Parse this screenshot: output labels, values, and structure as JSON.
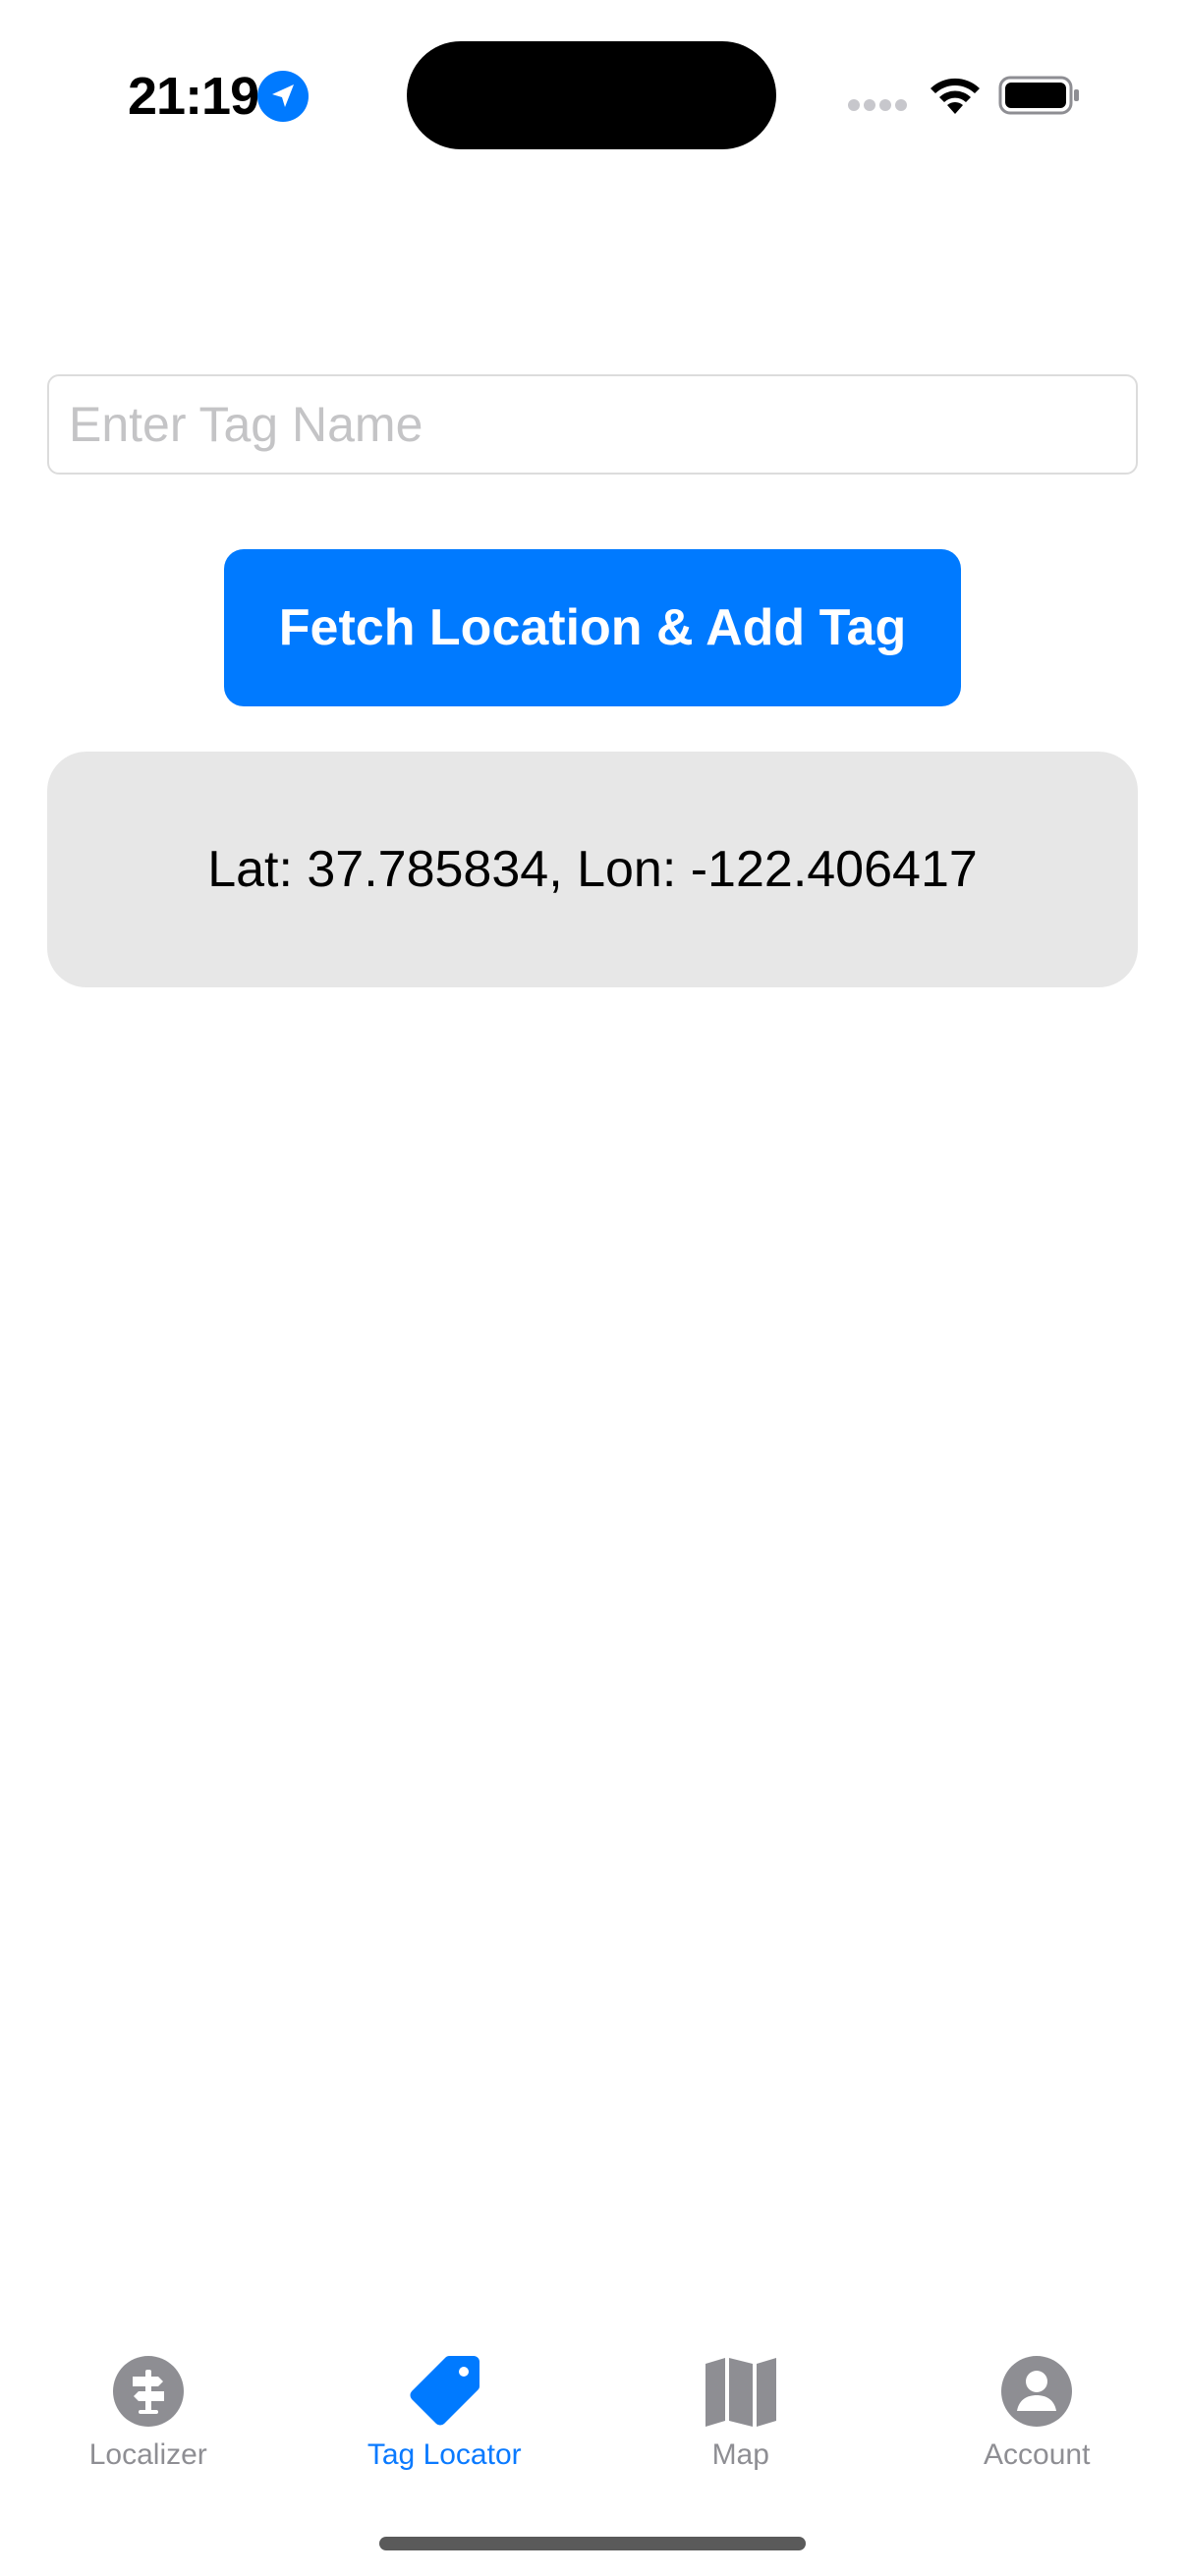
{
  "status_bar": {
    "time": "21:19",
    "icons": [
      "location-arrow-icon",
      "signal-dots-icon",
      "wifi-icon",
      "battery-icon"
    ]
  },
  "tag_input": {
    "placeholder": "Enter Tag Name",
    "value": ""
  },
  "fetch_button": {
    "label": "Fetch Location & Add Tag"
  },
  "location_card": {
    "text": "Lat: 37.785834, Lon: -122.406417"
  },
  "tab_bar": {
    "tabs": [
      {
        "label": "Localizer",
        "icon": "signpost-icon",
        "active": false
      },
      {
        "label": "Tag Locator",
        "icon": "tag-icon",
        "active": true
      },
      {
        "label": "Map",
        "icon": "map-icon",
        "active": false
      },
      {
        "label": "Account",
        "icon": "person-circle-icon",
        "active": false
      }
    ]
  },
  "colors": {
    "accent": "#007aff",
    "inactive_tab": "#8e8e93",
    "card_background": "#e7e7e7"
  }
}
